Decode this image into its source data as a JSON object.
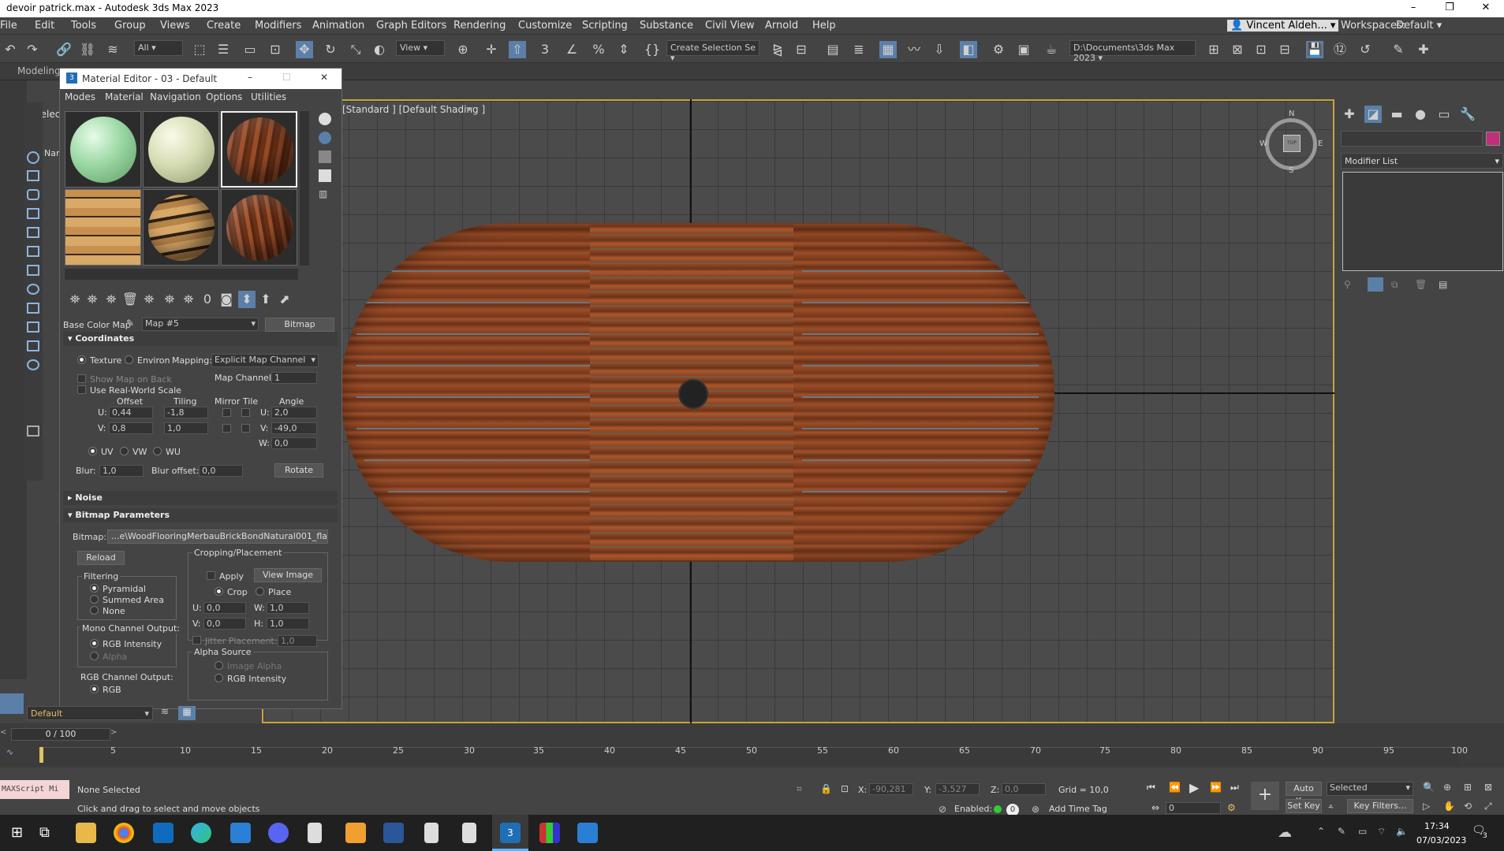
{
  "app": {
    "title": "devoir patrick.max - Autodesk 3ds Max 2023"
  },
  "menu": [
    "File",
    "Edit",
    "Tools",
    "Group",
    "Views",
    "Create",
    "Modifiers",
    "Animation",
    "Graph Editors",
    "Rendering",
    "Customize",
    "Scripting",
    "Substance",
    "Civil View",
    "Arnold",
    "Help"
  ],
  "user": {
    "name": "Vincent Aldeh...",
    "workspaces_label": "Workspaces:",
    "workspace": "Default"
  },
  "toolbar": {
    "filter": "All",
    "refcoord": "View",
    "selection_set": "Create Selection Se",
    "project_path": "D:\\Documents\\3ds Max 2023"
  },
  "ribbon": {
    "modeling": "Modeling",
    "select": "Select",
    "name": "Nar"
  },
  "viewport": {
    "label": "[Standard ] [Default Shading ]"
  },
  "compass": {
    "n": "N",
    "s": "S",
    "e": "E",
    "w": "W",
    "top": "TOP"
  },
  "command_panel": {
    "modifier_list": "Modifier List",
    "color": "#c0307a"
  },
  "material_editor": {
    "title": "Material Editor - 03 - Default",
    "menus": [
      "Modes",
      "Material",
      "Navigation",
      "Options",
      "Utilities"
    ],
    "base_color_label": "Base Color Map",
    "map_name": "Map #5",
    "map_type": "Bitmap",
    "coordinates": {
      "header": "Coordinates",
      "texture": "Texture",
      "environ": "Environ",
      "mapping_label": "Mapping:",
      "mapping": "Explicit Map Channel",
      "map_channel_label": "Map Channel:",
      "map_channel": "1",
      "show_map_on_back": "Show Map on Back",
      "use_real_world": "Use Real-World Scale",
      "offset": "Offset",
      "tiling": "Tiling",
      "mirror_tile": "Mirror Tile",
      "angle": "Angle",
      "u_label": "U:",
      "v_label": "V:",
      "w_label": "W:",
      "offset_u": "0,44",
      "offset_v": "0,8",
      "tiling_u": "-1,8",
      "tiling_v": "1,0",
      "angle_u": "2,0",
      "angle_v": "-49,0",
      "angle_w": "0,0",
      "uv": "UV",
      "vw": "VW",
      "wu": "WU",
      "blur_label": "Blur:",
      "blur": "1,0",
      "blur_offset_label": "Blur offset:",
      "blur_offset": "0,0",
      "rotate": "Rotate"
    },
    "noise": {
      "header": "Noise"
    },
    "bitmap_params": {
      "header": "Bitmap Parameters",
      "bitmap_label": "Bitmap:",
      "bitmap_path": "...e\\WoodFlooringMerbauBrickBondNatural001_flat.jpg",
      "reload": "Reload",
      "cropping": "Cropping/Placement",
      "apply": "Apply",
      "view_image": "View Image",
      "crop": "Crop",
      "place": "Place",
      "u_label": "U:",
      "v_label": "V:",
      "w_label": "W:",
      "h_label": "H:",
      "u": "0,0",
      "v": "0,0",
      "w": "1,0",
      "h": "1,0",
      "jitter": "Jitter Placement:",
      "jitter_val": "1,0",
      "filtering": "Filtering",
      "pyramidal": "Pyramidal",
      "summed_area": "Summed Area",
      "none": "None",
      "mono_output": "Mono Channel Output:",
      "rgb_intensity": "RGB Intensity",
      "alpha": "Alpha",
      "rgb_output": "RGB Channel Output:",
      "rgb": "RGB",
      "alpha_source": "Alpha Source",
      "image_alpha": "Image Alpha",
      "alpha_rgb_intensity": "RGB Intensity"
    }
  },
  "layer": {
    "name": "Default"
  },
  "timeline": {
    "frame": "0 / 100",
    "ticks": [
      "5",
      "10",
      "15",
      "20",
      "25",
      "30",
      "35",
      "40",
      "45",
      "50",
      "55",
      "60",
      "65",
      "70",
      "75",
      "80",
      "85",
      "90",
      "95",
      "100"
    ]
  },
  "status": {
    "maxscript": "MAXScript Mi",
    "selection": "None Selected",
    "prompt": "Click and drag to select and move objects",
    "x_label": "X:",
    "x": "-90,281",
    "y_label": "Y:",
    "y": "-3,527",
    "z_label": "Z:",
    "z": "0,0",
    "grid": "Grid = 10,0",
    "enabled": "Enabled:",
    "add_time_tag": "Add Time Tag",
    "auto_key": "Auto Key",
    "set_key": "Set Key",
    "selected": "Selected",
    "key_filters": "Key Filters...",
    "frame_field": "0"
  },
  "taskbar": {
    "time": "17:34",
    "date": "07/03/2023",
    "notif": "3"
  }
}
